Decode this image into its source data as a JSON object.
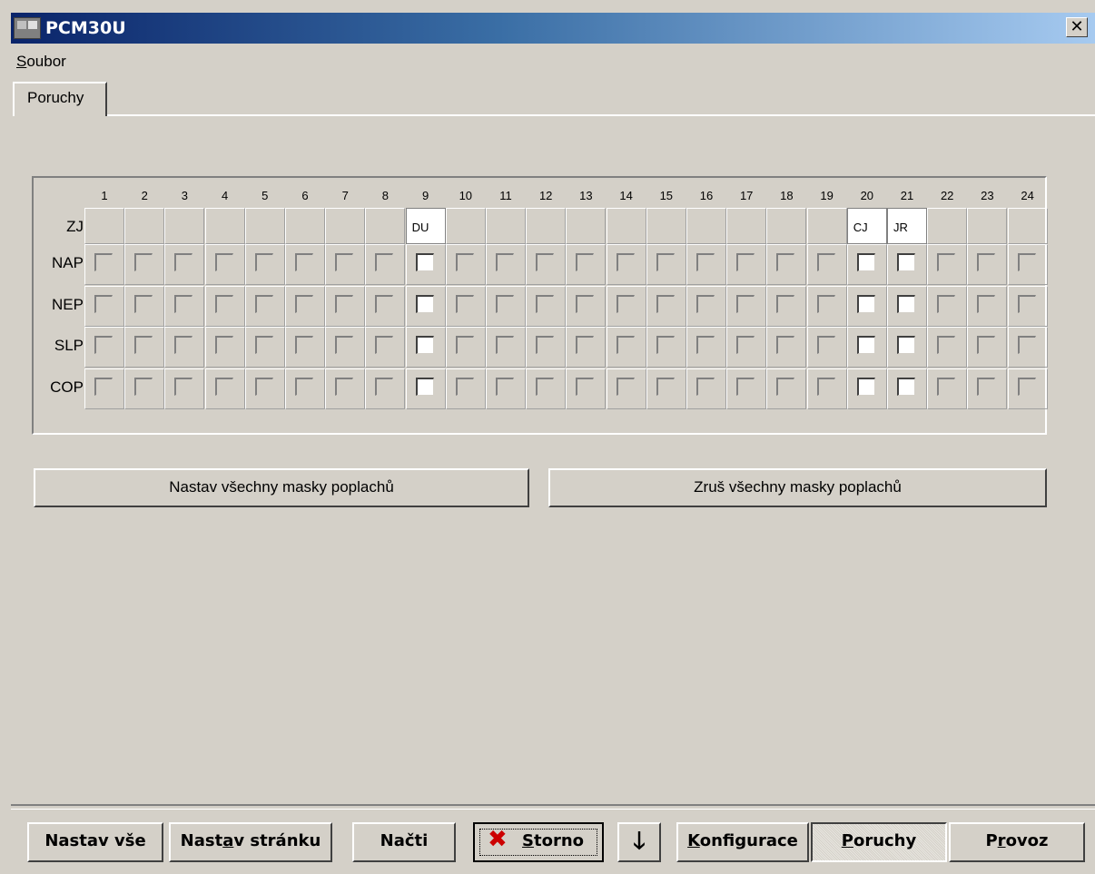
{
  "window": {
    "title": "PCM30U",
    "close_symbol": "✕"
  },
  "menu": {
    "items": [
      "Soubor"
    ]
  },
  "tabs": [
    "Poruchy"
  ],
  "grid": {
    "columns": [
      "1",
      "2",
      "3",
      "4",
      "5",
      "6",
      "7",
      "8",
      "9",
      "10",
      "11",
      "12",
      "13",
      "14",
      "15",
      "16",
      "17",
      "18",
      "19",
      "20",
      "21",
      "22",
      "23",
      "24"
    ],
    "zj_label": "ZJ",
    "zj_values": [
      "",
      "",
      "",
      "",
      "",
      "",
      "",
      "",
      "DU",
      "",
      "",
      "",
      "",
      "",
      "",
      "",
      "",
      "",
      "",
      "CJ",
      "JR",
      "",
      "",
      ""
    ],
    "rows": [
      "NAP",
      "NEP",
      "SLP",
      "COP"
    ],
    "active_columns": [
      9,
      20,
      21
    ]
  },
  "actions": {
    "set_all_masks": "Nastav všechny masky poplachů",
    "clear_all_masks": "Zruš všechny masky poplachů"
  },
  "toolbar": {
    "set_all": "Nastav vše",
    "set_page": "Nastav stránku",
    "load": "Načti",
    "cancel": "Storno",
    "configuration": "Konfigurace",
    "faults": "Poruchy",
    "operation": "Provoz"
  },
  "icons": {
    "app": "app-icon",
    "cancel": "red-x-icon",
    "download": "down-arrow-icon"
  },
  "colors": {
    "title_start": "#0a246a",
    "title_end": "#a6caf0",
    "face": "#d4d0c8",
    "cancel_icon": "#cc0000"
  }
}
